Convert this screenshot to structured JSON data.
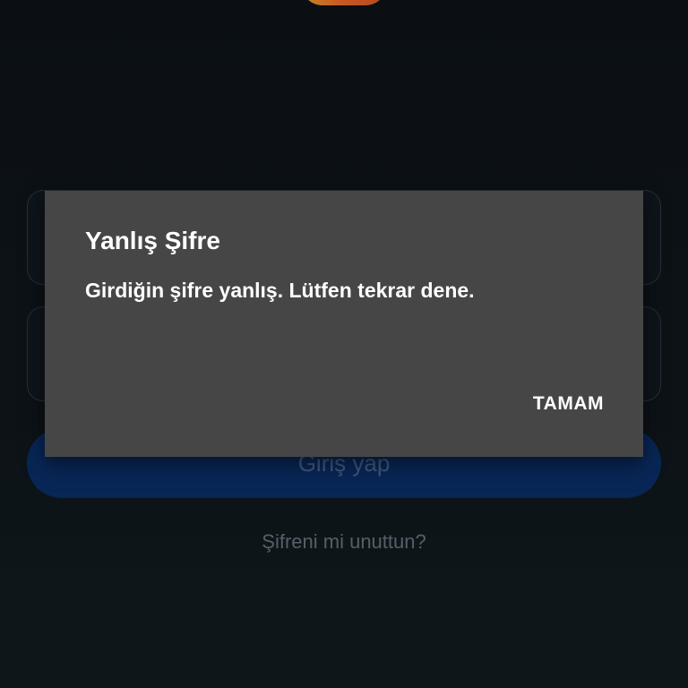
{
  "login": {
    "login_button_label": "Giriş yap",
    "forgot_password_label": "Şifreni mi unuttun?"
  },
  "dialog": {
    "title": "Yanlış Şifre",
    "message": "Girdiğin şifre yanlış. Lütfen tekrar dene.",
    "ok_label": "TAMAM"
  },
  "colors": {
    "background": "#0f1419",
    "dialog_background": "#464646",
    "login_button": "#0a2f6a",
    "logo_gradient_start": "#f9a52c",
    "logo_gradient_end": "#e0592a"
  }
}
